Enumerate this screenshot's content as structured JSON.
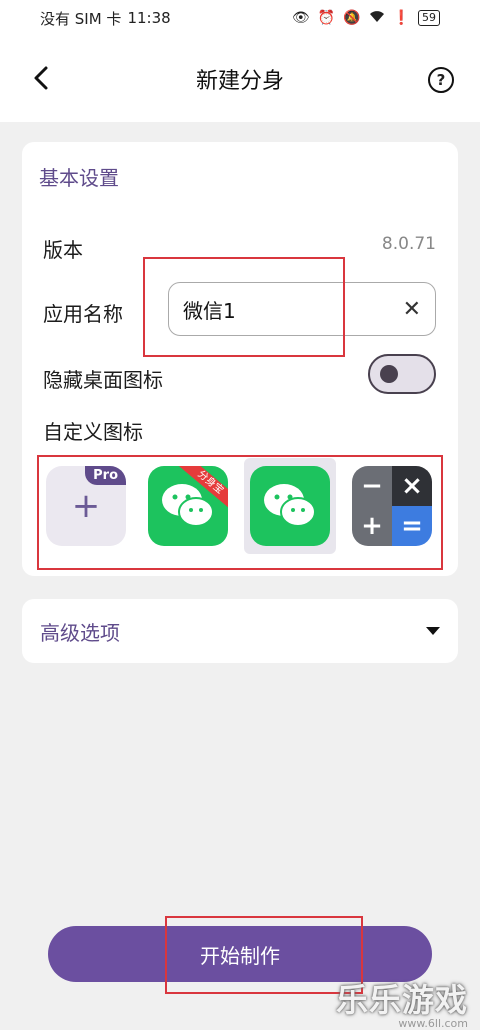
{
  "status": {
    "carrier": "没有 SIM 卡",
    "time": "11:38",
    "battery": "59",
    "icons": [
      "eye-icon",
      "alarm-icon",
      "mute-icon",
      "wifi-icon",
      "alert-icon",
      "battery-icon"
    ]
  },
  "header": {
    "title": "新建分身",
    "help": "?"
  },
  "basic": {
    "section_title": "基本设置",
    "version_label": "版本",
    "version_value": "8.0.71",
    "app_name_label": "应用名称",
    "app_name_value": "微信1",
    "hide_icon_label": "隐藏桌面图标",
    "hide_icon_on": false,
    "custom_icon_label": "自定义图标",
    "icons": [
      {
        "type": "add",
        "badge": "Pro"
      },
      {
        "type": "wechat",
        "ribbon": "分身宝"
      },
      {
        "type": "wechat",
        "selected": true
      },
      {
        "type": "calculator"
      }
    ]
  },
  "advanced": {
    "label": "高级选项"
  },
  "start_button": {
    "label": "开始制作"
  },
  "watermark": {
    "main": "乐乐游戏",
    "sub": "www.6ll.com"
  },
  "colors": {
    "accent": "#6b4fa0",
    "section_text": "#5f4b8b",
    "wechat_green": "#1dc35e",
    "highlight_red": "#d9363e"
  }
}
